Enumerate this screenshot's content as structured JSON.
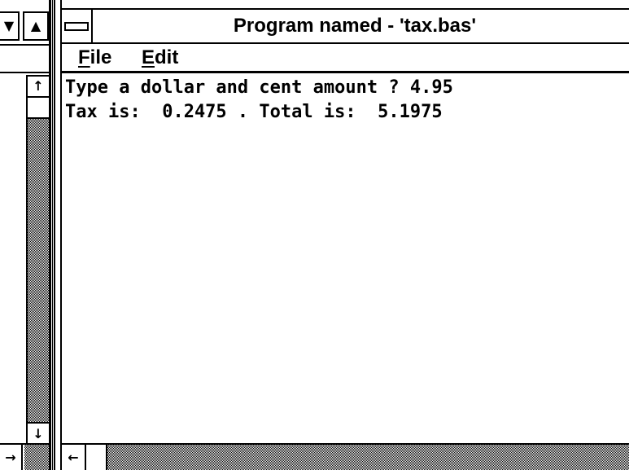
{
  "window": {
    "title": "Program named - 'tax.bas'"
  },
  "menu": {
    "items": [
      {
        "label": "File",
        "mnemonic": "F",
        "rest": "ile"
      },
      {
        "label": "Edit",
        "mnemonic": "E",
        "rest": "dit"
      }
    ]
  },
  "console": {
    "lines": [
      "Type a dollar and cent amount ? 4.95",
      "Tax is:  0.2475 . Total is:  5.1975"
    ]
  },
  "icons": {
    "scroll_down": "▼",
    "scroll_up": "▲",
    "arrow_up": "↑",
    "arrow_down": "↓",
    "arrow_left": "←",
    "arrow_right": "→",
    "system_menu": "system-menu-icon"
  }
}
